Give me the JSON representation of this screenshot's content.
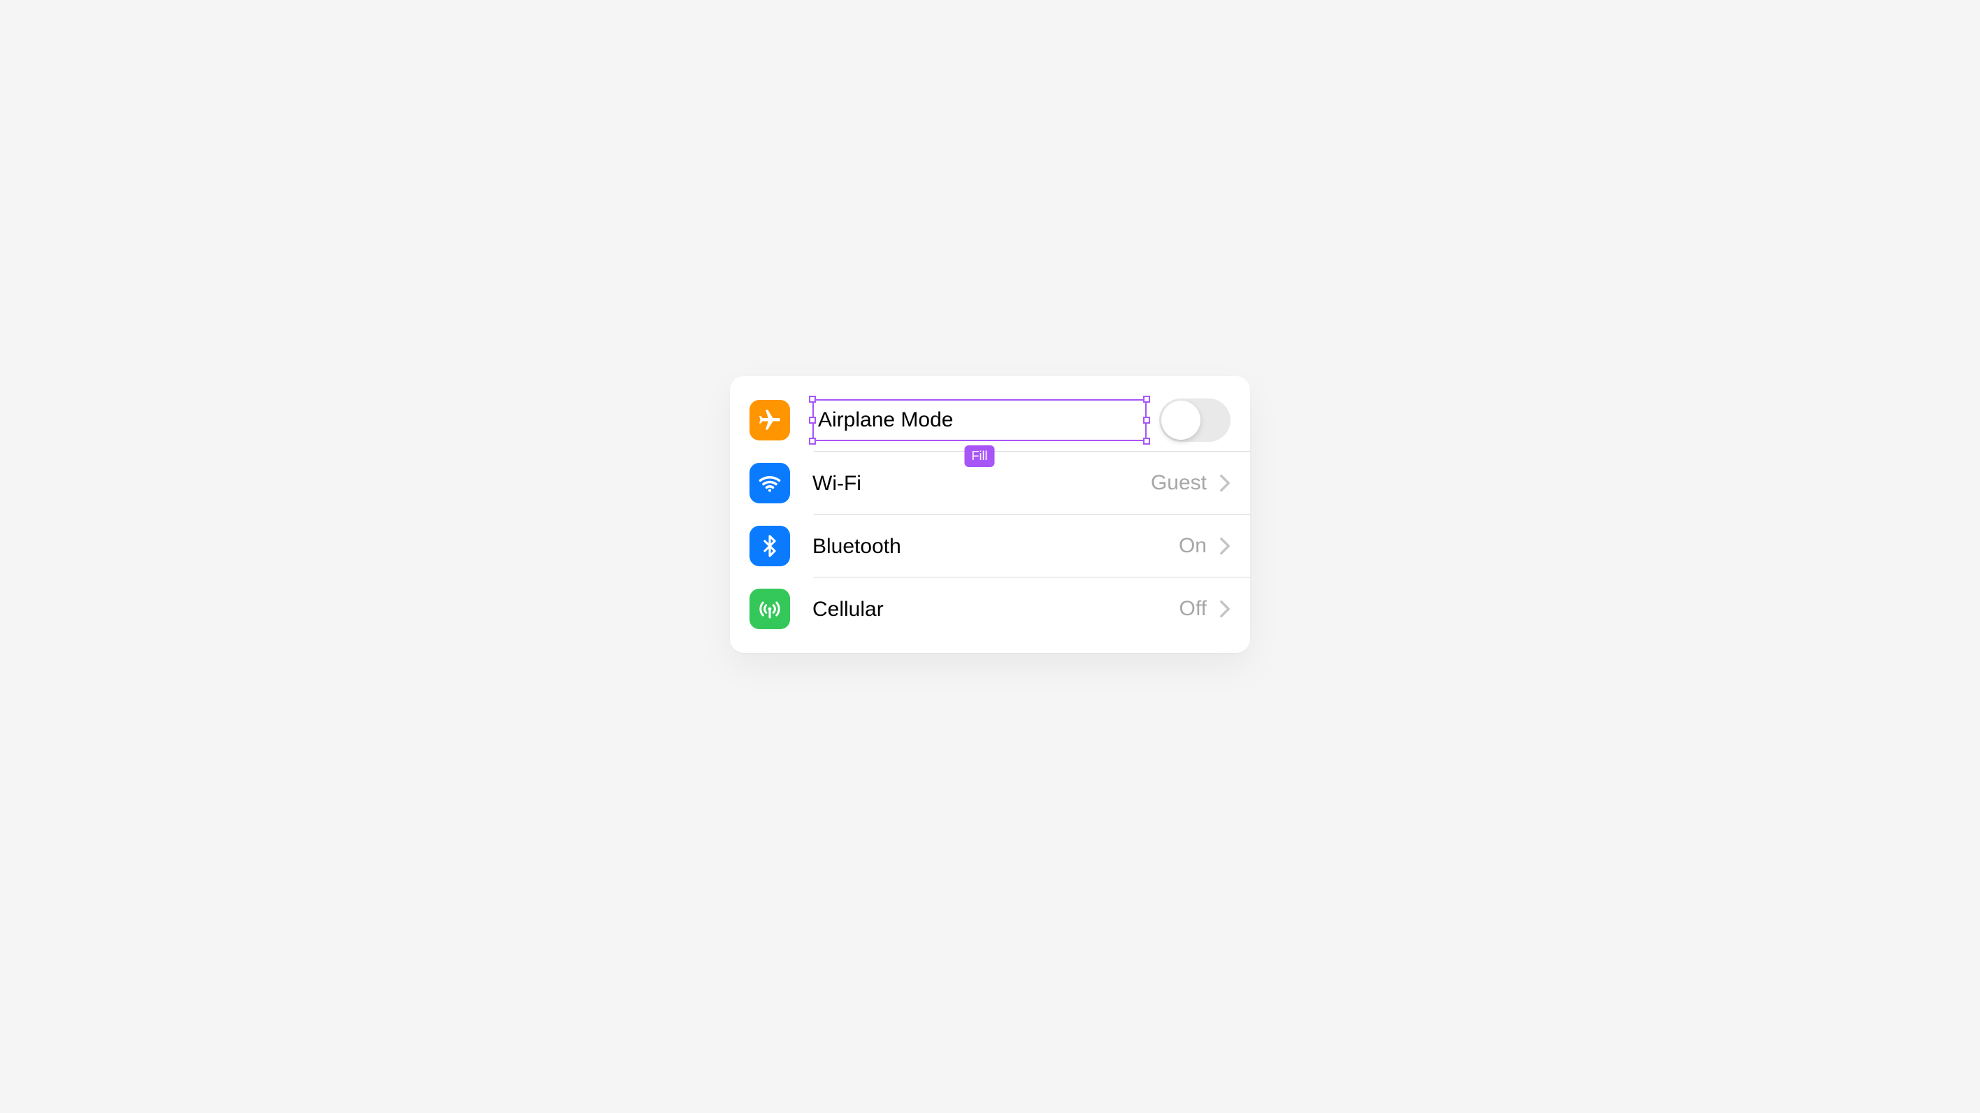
{
  "selection_badge_label": "Fill",
  "settings": {
    "items": [
      {
        "id": "airplane",
        "label": "Airplane Mode",
        "icon": "airplane-icon",
        "color": "orange",
        "control": "toggle",
        "toggle_on": false,
        "selected": true
      },
      {
        "id": "wifi",
        "label": "Wi-Fi",
        "icon": "wifi-icon",
        "color": "blue",
        "control": "disclosure",
        "detail": "Guest"
      },
      {
        "id": "bluetooth",
        "label": "Bluetooth",
        "icon": "bluetooth-icon",
        "color": "blue",
        "control": "disclosure",
        "detail": "On"
      },
      {
        "id": "cellular",
        "label": "Cellular",
        "icon": "cellular-icon",
        "color": "green",
        "control": "disclosure",
        "detail": "Off"
      }
    ]
  },
  "colors": {
    "orange": "#ff9500",
    "blue": "#0a7bff",
    "green": "#34c759",
    "selection": "#a855f7"
  }
}
